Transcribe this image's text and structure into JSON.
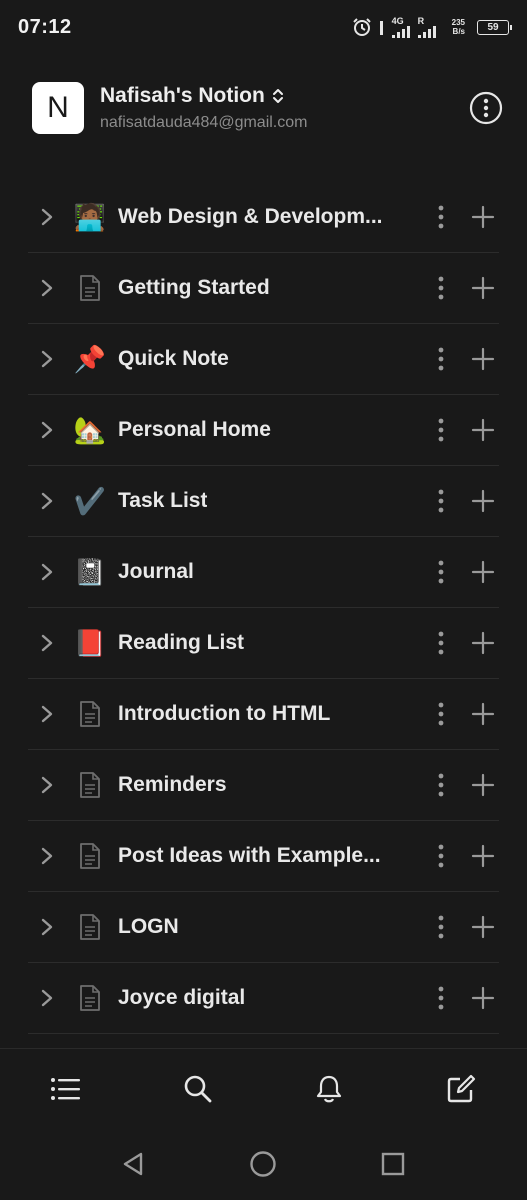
{
  "status_bar": {
    "time": "07:12",
    "network_1": "4G",
    "network_2": "R",
    "speed_value": "235",
    "speed_unit": "B/s",
    "battery": "59"
  },
  "workspace": {
    "avatar_letter": "N",
    "name": "Nafisah's Notion",
    "email": "nafisatdauda484@gmail.com"
  },
  "pages": [
    {
      "icon": "🧑🏾‍💻",
      "label": "Web Design & Developm..."
    },
    {
      "icon": "doc",
      "label": "Getting Started"
    },
    {
      "icon": "📌",
      "label": "Quick Note"
    },
    {
      "icon": "🏡",
      "label": "Personal Home"
    },
    {
      "icon": "✔️",
      "label": "Task List"
    },
    {
      "icon": "📓",
      "label": "Journal"
    },
    {
      "icon": "📕",
      "label": "Reading List"
    },
    {
      "icon": "doc",
      "label": "Introduction to HTML"
    },
    {
      "icon": "doc",
      "label": "Reminders"
    },
    {
      "icon": "doc",
      "label": "Post Ideas with Example..."
    },
    {
      "icon": "doc",
      "label": "LOGN"
    },
    {
      "icon": "doc",
      "label": "Joyce digital"
    }
  ],
  "bottom_nav": [
    "list-icon",
    "search-icon",
    "bell-icon",
    "compose-icon"
  ],
  "system_nav": [
    "back-icon",
    "home-icon",
    "recents-icon"
  ]
}
